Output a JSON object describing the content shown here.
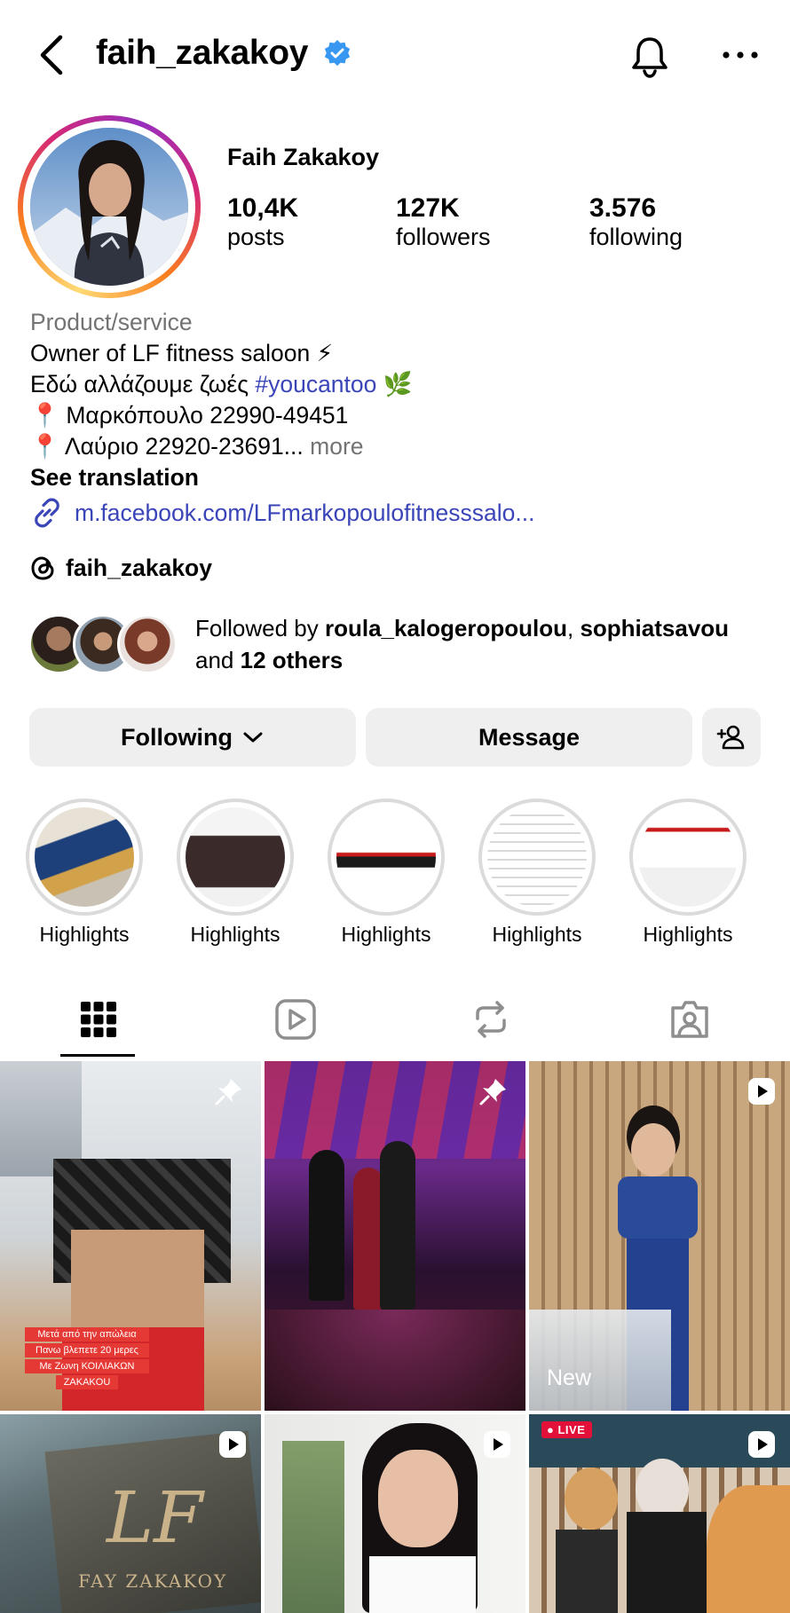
{
  "header": {
    "username": "faih_zakakoy"
  },
  "profile": {
    "full_name": "Faih Zakakoy",
    "stats": [
      {
        "value": "10,4K",
        "label": "posts"
      },
      {
        "value": "127K",
        "label": "followers"
      },
      {
        "value": "3.576",
        "label": "following"
      }
    ]
  },
  "bio": {
    "category": "Product/service",
    "line1": "Owner of LF fitness saloon ⚡",
    "line2_text": "Εδώ αλλάζουμε ζωές ",
    "line2_tag": "#youcantoo",
    "line2_emoji": " 🌿",
    "line3": "📍 Μαρκόπουλο 22990-49451",
    "line4": "📍 Λαύριο 22920-23691...",
    "more": "more",
    "see_translation": "See translation",
    "link": "m.facebook.com/LFmarkopoulofitnesssalo...",
    "threads": "faih_zakakoy"
  },
  "followed_by": {
    "prefix": "Followed by ",
    "user1": "roula_kalogeropoulou",
    "sep": ", ",
    "user2": "sophiatsavou",
    "and": "and ",
    "others": "12 others"
  },
  "buttons": {
    "following": "Following",
    "message": "Message"
  },
  "highlights": [
    {
      "label": "Highlights"
    },
    {
      "label": "Highlights"
    },
    {
      "label": "Highlights"
    },
    {
      "label": "Highlights"
    },
    {
      "label": "Highlights"
    }
  ],
  "grid": {
    "cell1_caption_1": "Μετά από την απώλεια",
    "cell1_caption_2": "Πανω βλεπετε 20 μερες",
    "cell1_caption_3": "Με Ζωνη ΚΟΙΛΙΑΚΩΝ",
    "cell1_caption_4": "ZAKAKOU",
    "cell3_new": "New",
    "cell6_live": "LIVE",
    "cell4_brand": "FAY ZAKAKOY"
  },
  "colors": {
    "verified": "#3897f0",
    "link": "#3a45b8",
    "button_bg": "#efefef",
    "secondary_text": "#737373"
  }
}
